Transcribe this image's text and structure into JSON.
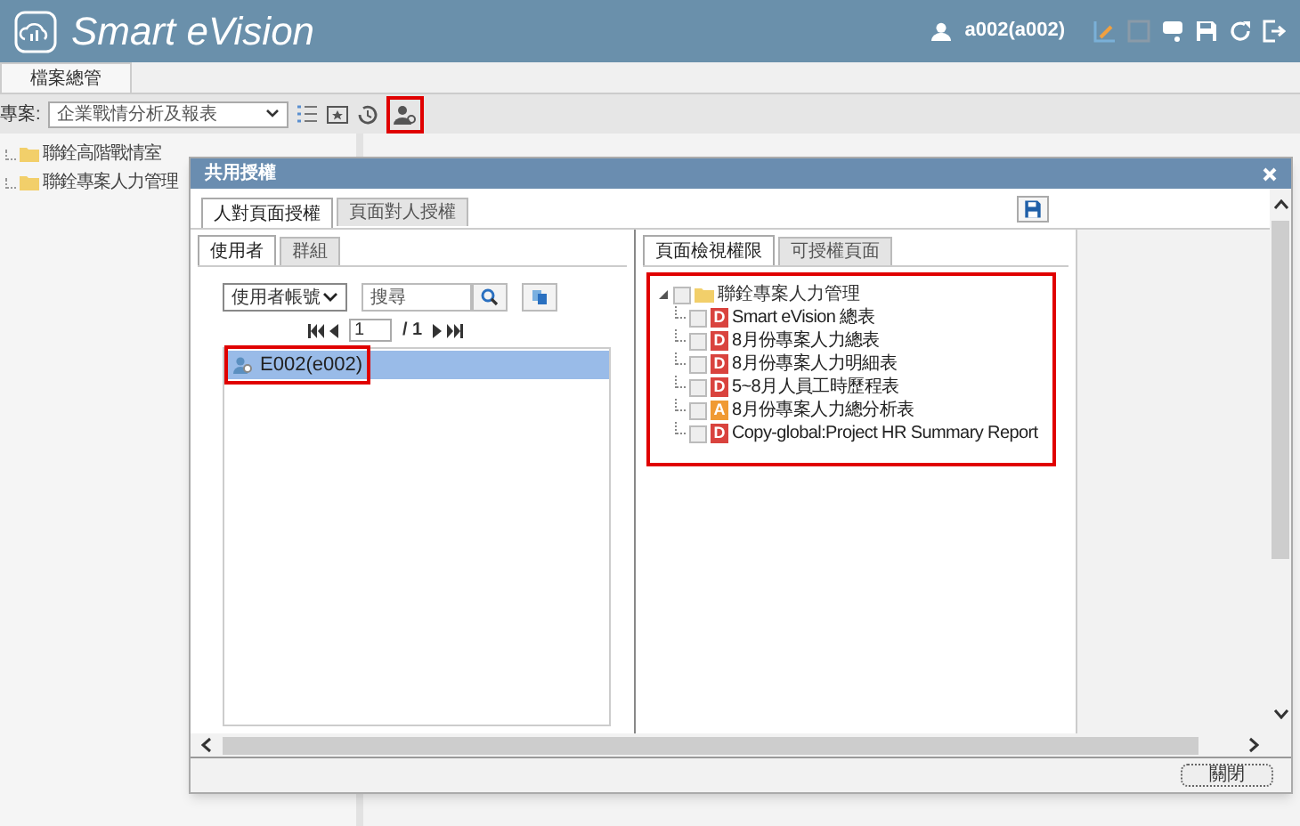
{
  "header": {
    "title": "Smart eVision",
    "user": "a002(a002)"
  },
  "tabs": [
    {
      "label": "檔案總管",
      "selected": true
    }
  ],
  "toolbar": {
    "project_label": "專案:",
    "project_value": "企業戰情分析及報表"
  },
  "tree": [
    {
      "label": "聯銓高階戰情室"
    },
    {
      "label": "聯銓專案人力管理"
    }
  ],
  "dialog": {
    "title": "共用授權",
    "tabs": [
      {
        "label": "人對頁面授權",
        "selected": true
      },
      {
        "label": "頁面對人授權",
        "selected": false
      }
    ],
    "left_tabs": [
      {
        "label": "使用者",
        "selected": true
      },
      {
        "label": "群組",
        "selected": false
      }
    ],
    "filter_value": "使用者帳號",
    "search_placeholder": "搜尋",
    "page": "1",
    "page_total": "/ 1",
    "users": [
      {
        "label": "E002(e002)",
        "selected": true
      }
    ],
    "right_tabs": [
      {
        "label": "頁面檢視權限",
        "selected": true
      },
      {
        "label": "可授權頁面",
        "selected": false
      }
    ],
    "page_tree": {
      "label": "聯銓專案人力管理",
      "checked": false,
      "expanded": true,
      "children": [
        {
          "label": "Smart eVision 總表",
          "type": "D",
          "checked": false
        },
        {
          "label": "8月份專案人力總表",
          "type": "D",
          "checked": false
        },
        {
          "label": "8月份專案人力明細表",
          "type": "D",
          "checked": false
        },
        {
          "label": "5~8月人員工時歷程表",
          "type": "D",
          "checked": false
        },
        {
          "label": "8月份專案人力總分析表",
          "type": "A",
          "checked": false
        },
        {
          "label": "Copy-global:Project HR Summary Report",
          "type": "D",
          "checked": false
        }
      ]
    },
    "close_button": "關閉"
  }
}
